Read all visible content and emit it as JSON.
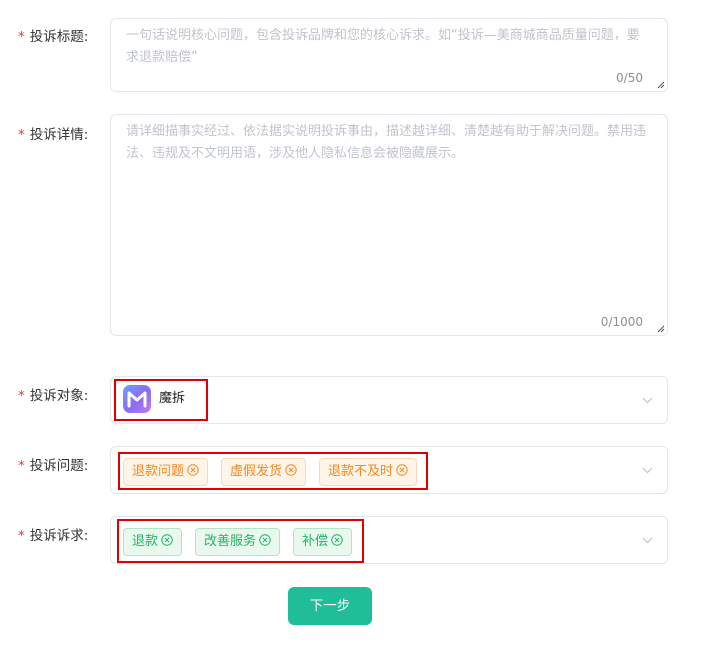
{
  "form": {
    "required_mark": "*",
    "title": {
      "label": "投诉标题:",
      "placeholder": "一句话说明核心问题，包含投诉品牌和您的核心诉求。如“投诉—美商城商品质量问题，要求退款赔偿”",
      "counter": "0/50"
    },
    "detail": {
      "label": "投诉详情:",
      "placeholder": "请详细描事实经过、依法据实说明投诉事由，描述越详细、清楚越有助于解决问题。禁用违法、违规及不文明用语，涉及他人隐私信息会被隐藏展示。",
      "counter": "0/1000"
    },
    "target": {
      "label": "投诉对象:",
      "selected": "魔拆",
      "logo_icon": "moche-logo-icon"
    },
    "issue": {
      "label": "投诉问题:",
      "tags": [
        "退款问题",
        "虚假发货",
        "退款不及时"
      ],
      "tag_color": "#f08a24"
    },
    "demand": {
      "label": "投诉诉求:",
      "tags": [
        "退款",
        "改善服务",
        "补偿"
      ],
      "tag_color": "#22b462"
    }
  },
  "next_button": "下一步",
  "colors": {
    "accent": "#1fbd98",
    "required": "#e5382d",
    "highlight": "#e10000"
  }
}
